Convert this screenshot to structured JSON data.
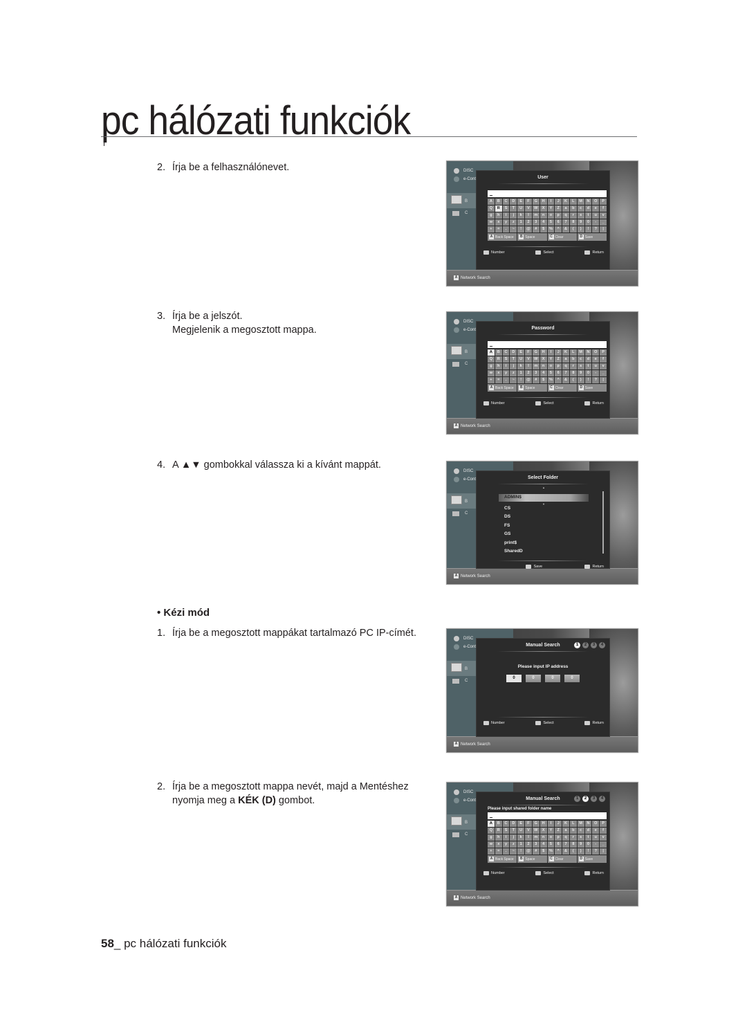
{
  "page": {
    "title": "pc hálózati funkciók",
    "footer_num": "58",
    "footer_text": "_ pc hálózati funkciók"
  },
  "steps": {
    "s2": {
      "num": "2.",
      "text": "Írja be a felhasználónevet."
    },
    "s3": {
      "num": "3.",
      "line1": "Írja be a jelszót.",
      "line2": "Megjelenik a megosztott mappa."
    },
    "s4": {
      "num": "4.",
      "text": "A ▲▼ gombokkal válassza ki a kívánt mappát."
    },
    "manual_heading": "• Kézi mód",
    "m1": {
      "num": "1.",
      "text": "Írja be a megosztott mappákat tartalmazó PC IP-címét."
    },
    "m2": {
      "num": "2.",
      "line1": "Írja be a megosztott mappa nevét, majd a Mentéshez",
      "line2_pre": "nyomja meg a ",
      "line2_bold": "KÉK (D)",
      "line2_post": " gombot."
    }
  },
  "tv": {
    "menu": {
      "disc": "DISC",
      "econt": "e-Cont",
      "pc": "B",
      "c": "C"
    },
    "bottom": {
      "key": "A",
      "label": "Network Search"
    },
    "keyboard_rows": [
      [
        "A",
        "B",
        "C",
        "D",
        "E",
        "F",
        "G",
        "H",
        "I",
        "J",
        "K",
        "L",
        "M",
        "N",
        "O",
        "P"
      ],
      [
        "Q",
        "R",
        "S",
        "T",
        "U",
        "V",
        "W",
        "X",
        "Y",
        "Z",
        "a",
        "b",
        "c",
        "d",
        "e",
        "f"
      ],
      [
        "g",
        "h",
        "i",
        "j",
        "k",
        "l",
        "m",
        "n",
        "o",
        "p",
        "q",
        "r",
        "s",
        "t",
        "u",
        "v"
      ],
      [
        "w",
        "x",
        "y",
        "z",
        "1",
        "2",
        "3",
        "4",
        "5",
        "6",
        "7",
        "8",
        "9",
        "0",
        "-",
        "_"
      ],
      [
        "+",
        "=",
        ".",
        "~",
        "!",
        "@",
        "#",
        "$",
        "%",
        "^",
        "&",
        "(",
        ")",
        "!",
        "?",
        "|"
      ]
    ],
    "fkeys": [
      {
        "key": "A",
        "label": "Back Space"
      },
      {
        "key": "B",
        "label": "Space"
      },
      {
        "key": "C",
        "label": "Clear"
      },
      {
        "key": "D",
        "label": "Save"
      }
    ],
    "hints": {
      "number": "Number",
      "select": "Select",
      "return": "Return",
      "save": "Save"
    }
  },
  "screens": {
    "user": {
      "title": "User",
      "input": "_",
      "selected_key": "R"
    },
    "password": {
      "title": "Password",
      "input": "_",
      "selected_key": "A"
    },
    "folder": {
      "title": "Select Folder",
      "items": [
        "ADMIN$",
        "CS",
        "DS",
        "FS",
        "GS",
        "print$",
        "SharedD"
      ],
      "selected": "ADMIN$"
    },
    "manual1": {
      "title": "Manual Search",
      "steps": [
        "1",
        "2",
        "3",
        "4"
      ],
      "active_step": "1",
      "prompt": "Please input IP address",
      "ip": [
        "0",
        "0",
        "0",
        "0"
      ]
    },
    "manual2": {
      "title": "Manual Search",
      "steps": [
        "1",
        "2",
        "3",
        "4"
      ],
      "active_step": "2",
      "prompt": "Please input shared folder name",
      "input": "_",
      "selected_key": "A"
    }
  }
}
